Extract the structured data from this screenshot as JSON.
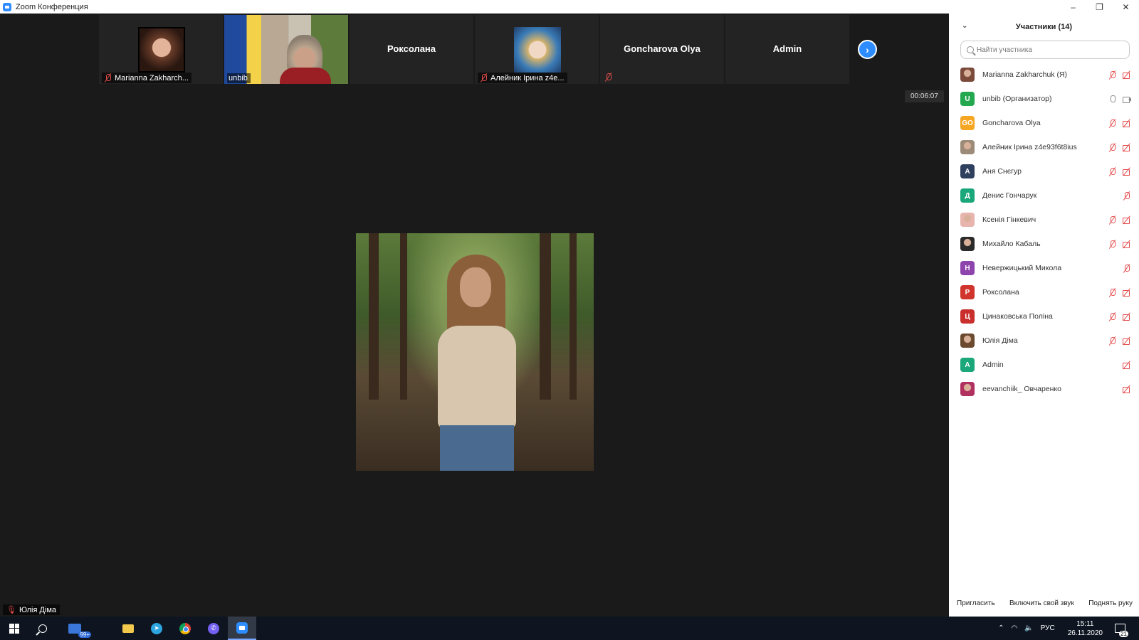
{
  "window": {
    "title": "Zoom Конференция",
    "minimize": "–",
    "restore": "❐",
    "close": "✕"
  },
  "gallery": {
    "tiles": [
      {
        "name": "Marianna Zakharch...",
        "type": "photo-marianna",
        "mic_off": true
      },
      {
        "name": "unbib",
        "type": "video",
        "mic_off": true
      },
      {
        "name": "Роксолана",
        "type": "name-only",
        "mic_off": false
      },
      {
        "name": "Алейник Ірина z4e...",
        "type": "photo-aleinik",
        "mic_off": true
      },
      {
        "name": "Goncharova Olya",
        "type": "name-only",
        "mic_off": true
      },
      {
        "name": "Admin",
        "type": "name-only",
        "mic_off": false
      }
    ],
    "next_icon": "chevron-right-icon"
  },
  "timer": "00:06:07",
  "active_speaker": {
    "name": "Юлія Діма"
  },
  "participants_panel": {
    "title": "Участники (14)",
    "search_placeholder": "Найти участника",
    "participants": [
      {
        "name": "Marianna Zakharchuk (Я)",
        "avatar": "",
        "avatar_color": "#7a4a3a",
        "photo": true,
        "mic": "off",
        "cam": "off"
      },
      {
        "name": "unbib (Организатор)",
        "avatar": "U",
        "avatar_color": "#23a850",
        "photo": false,
        "mic": "on",
        "cam": "on"
      },
      {
        "name": "Goncharova Olya",
        "avatar": "GO",
        "avatar_color": "#f5a623",
        "photo": false,
        "mic": "off",
        "cam": "off"
      },
      {
        "name": "Алейник Ірина z4e93f6t8ius",
        "avatar": "",
        "avatar_color": "#9c8b78",
        "photo": true,
        "mic": "off",
        "cam": "off"
      },
      {
        "name": "Аня Снєгур",
        "avatar": "А",
        "avatar_color": "#2f3f5e",
        "photo": false,
        "mic": "off",
        "cam": "off"
      },
      {
        "name": "Денис Гончарук",
        "avatar": "Д",
        "avatar_color": "#1aa77a",
        "photo": false,
        "mic": "off",
        "cam": "none"
      },
      {
        "name": "Ксенія Гінкевич",
        "avatar": "",
        "avatar_color": "#e8b4ae",
        "photo": true,
        "mic": "off",
        "cam": "off"
      },
      {
        "name": "Михайло Кабаль",
        "avatar": "",
        "avatar_color": "#2a2a2a",
        "photo": true,
        "mic": "off",
        "cam": "off"
      },
      {
        "name": "Невержицький Микола",
        "avatar": "Н",
        "avatar_color": "#8e44ad",
        "photo": false,
        "mic": "off",
        "cam": "none"
      },
      {
        "name": "Роксолана",
        "avatar": "Р",
        "avatar_color": "#d0342c",
        "photo": false,
        "mic": "off",
        "cam": "off"
      },
      {
        "name": "Цинаковська Поліна",
        "avatar": "Ц",
        "avatar_color": "#c9302c",
        "photo": false,
        "mic": "off",
        "cam": "off"
      },
      {
        "name": "Юлія Діма",
        "avatar": "",
        "avatar_color": "#6b4a2f",
        "photo": true,
        "mic": "off",
        "cam": "off"
      },
      {
        "name": "Admin",
        "avatar": "A",
        "avatar_color": "#1aa77a",
        "photo": false,
        "mic": "none",
        "cam": "off"
      },
      {
        "name": "eevanchiik_ Овчаренко",
        "avatar": "",
        "avatar_color": "#b03060",
        "photo": true,
        "mic": "none",
        "cam": "off"
      }
    ],
    "footer": {
      "invite": "Пригласить",
      "unmute": "Включить свой звук",
      "raise_hand": "Поднять руку"
    }
  },
  "taskbar": {
    "badge": "99+",
    "tray_lang": "РУС",
    "time": "15:11",
    "date": "26.11.2020",
    "notifications": "21"
  }
}
